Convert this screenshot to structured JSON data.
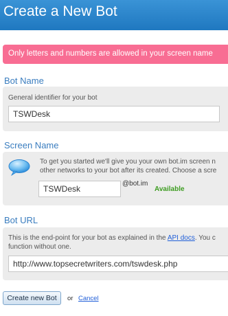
{
  "header": {
    "title": "Create a New Bot"
  },
  "error": {
    "message": "Only letters and numbers are allowed in your screen name"
  },
  "bot_name": {
    "title": "Bot Name",
    "hint": "General identifier for your bot",
    "value": "TSWDesk"
  },
  "screen_name": {
    "title": "Screen Name",
    "hint_line1": "To get you started we'll give you your own bot.im screen n",
    "hint_line2": "other networks to your bot after its created. Choose a scre",
    "value": "TSWDesk",
    "suffix": "@bot.im",
    "status": "Available",
    "icon": "speech-bubble-icon"
  },
  "bot_url": {
    "title": "Bot URL",
    "hint_before": "This is the end-point for your bot as explained in the ",
    "hint_link": "API docs",
    "hint_after": ". You c",
    "hint_line2": "function without one.",
    "value": "http://www.topsecretwriters.com/tswdesk.php"
  },
  "actions": {
    "create_label": "Create new Bot",
    "or_label": "or",
    "cancel_label": "Cancel"
  },
  "colors": {
    "header": "#1f78c0",
    "error": "#f86d93",
    "section_title": "#3a7dbf",
    "available": "#3d9c20"
  }
}
